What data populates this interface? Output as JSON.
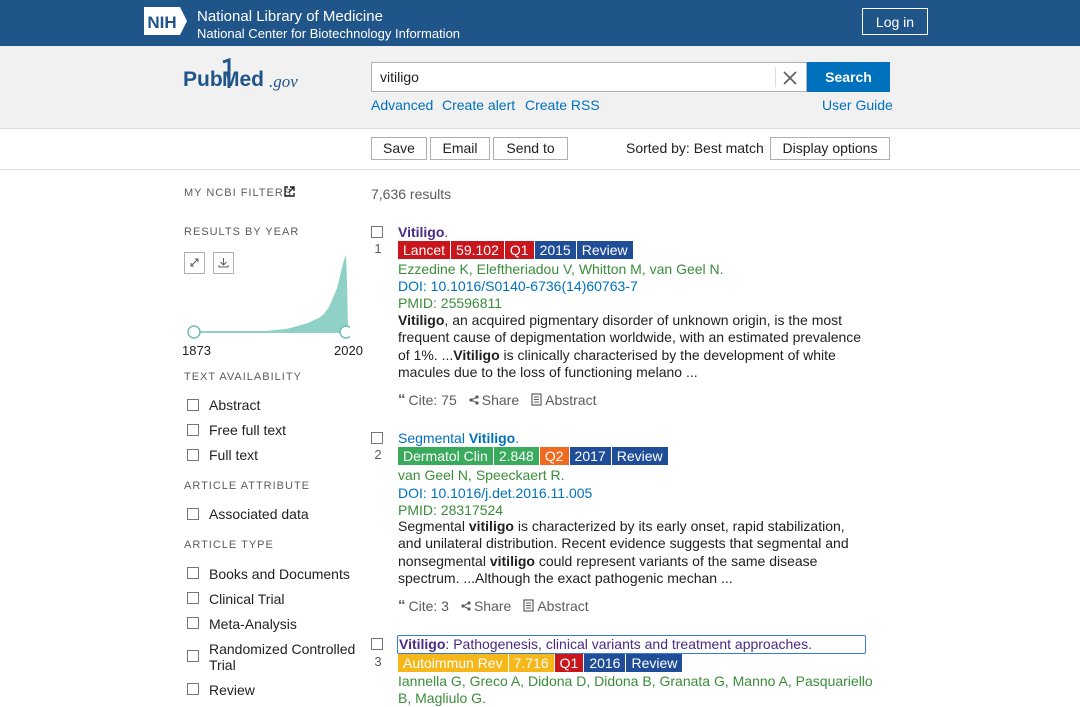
{
  "header": {
    "nih_logo_text": "NIH",
    "org_line1": "National Library of Medicine",
    "org_line2": "National Center for Biotechnology Information",
    "login_label": "Log in"
  },
  "search": {
    "logo_text": "PubMed.gov",
    "query": "vitiligo",
    "button_label": "Search",
    "links": [
      "Advanced",
      "Create alert",
      "Create RSS"
    ],
    "user_guide": "User Guide"
  },
  "toolbar": {
    "save": "Save",
    "email": "Email",
    "send_to": "Send to",
    "sorted_by": "Sorted by: Best match",
    "display_options": "Display options"
  },
  "sidebar": {
    "my_ncbi_filters": "MY NCBI FILTERS",
    "results_by_year": "RESULTS BY YEAR",
    "year_start": "1873",
    "year_end": "2020",
    "text_availability": {
      "heading": "TEXT AVAILABILITY",
      "items": [
        "Abstract",
        "Free full text",
        "Full text"
      ]
    },
    "article_attribute": {
      "heading": "ARTICLE ATTRIBUTE",
      "items": [
        "Associated data"
      ]
    },
    "article_type": {
      "heading": "ARTICLE TYPE",
      "items": [
        "Books and Documents",
        "Clinical Trial",
        "Meta-Analysis",
        "Randomized Controlled Trial",
        "Review"
      ]
    }
  },
  "results": {
    "count": "7,636 results",
    "items": [
      {
        "num": "1",
        "title_bold": "Vitiligo",
        "title_rest": ".",
        "badges": [
          {
            "text": "Lancet",
            "color": "#c9161d"
          },
          {
            "text": "59.102",
            "color": "#c9161d"
          },
          {
            "text": "Q1",
            "color": "#c9161d"
          },
          {
            "text": "2015",
            "color": "#1f4d97"
          },
          {
            "text": "Review",
            "color": "#1f4d97"
          }
        ],
        "authors": "Ezzedine K, Eleftheriadou V, Whitton M, van Geel N.",
        "doi": "DOI: 10.1016/S0140-6736(14)60763-7",
        "pmid": "PMID: 25596811",
        "snippet_html": "<b>Vitiligo</b>, an acquired pigmentary disorder of unknown origin, is the most frequent cause of depigmentation worldwide, with an estimated prevalence of 1%. ...<b>Vitiligo</b> is clinically characterised by the development of white macules due to the loss of functioning melano ...",
        "cite": "Cite: 75",
        "share": "Share",
        "abstract": "Abstract"
      },
      {
        "num": "2",
        "title_pre": "Segmental ",
        "title_bold": "Vitiligo",
        "title_rest": ".",
        "badges": [
          {
            "text": "Dermatol Clin",
            "color": "#3aaa5c"
          },
          {
            "text": "2.848",
            "color": "#3aaa5c"
          },
          {
            "text": "Q2",
            "color": "#f06a22"
          },
          {
            "text": "2017",
            "color": "#1f4d97"
          },
          {
            "text": "Review",
            "color": "#1f4d97"
          }
        ],
        "authors": "van Geel N, Speeckaert R.",
        "doi": "DOI: 10.1016/j.det.2016.11.005",
        "pmid": "PMID: 28317524",
        "snippet_html": "Segmental <b>vitiligo</b> is characterized by its early onset, rapid stabilization, and unilateral distribution. Recent evidence suggests that segmental and nonsegmental <b>vitiligo</b> could represent variants of the same disease spectrum. ...Although the exact pathogenic mechan ...",
        "cite": "Cite: 3",
        "share": "Share",
        "abstract": "Abstract"
      },
      {
        "num": "3",
        "title_bold": "Vitiligo",
        "title_rest": ": Pathogenesis, clinical variants and treatment approaches.",
        "badges": [
          {
            "text": "Autoimmun Rev",
            "color": "#f5b719"
          },
          {
            "text": "7.716",
            "color": "#f5b719"
          },
          {
            "text": "Q1",
            "color": "#c9161d"
          },
          {
            "text": "2016",
            "color": "#1f4d97"
          },
          {
            "text": "Review",
            "color": "#1f4d97"
          }
        ],
        "authors_line1": "Iannella G, Greco A, Didona D, Didona B, Granata G, Manno A, Pasquariello",
        "authors_line2": "B, Magliulo G."
      }
    ]
  }
}
